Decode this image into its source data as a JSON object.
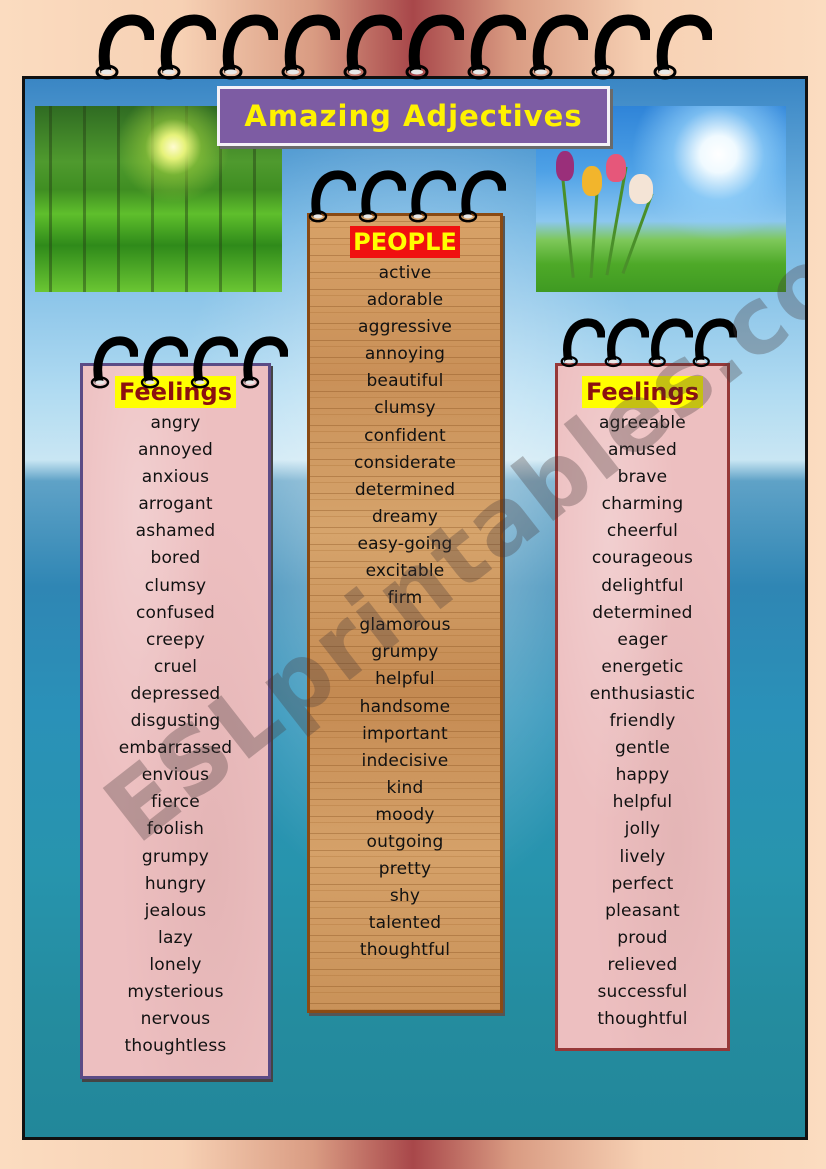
{
  "title": "Amazing Adjectives",
  "watermark": "ESLprintables.com",
  "colors": {
    "title_bg": "#7d5ca3",
    "title_text": "#fff200",
    "feelings_heading_bg": "#ffff00",
    "feelings_heading_text": "#8b1010",
    "people_heading_bg": "#f01010",
    "people_heading_text": "#ffff00",
    "left_panel_border": "#5b4b85",
    "right_panel_border": "#963838",
    "center_panel_border": "#8a4a13"
  },
  "images": {
    "left": "forest-sunlight-image",
    "right": "tulips-sky-image"
  },
  "left_panel": {
    "heading": "Feelings",
    "words": [
      "angry",
      "annoyed",
      "anxious",
      "arrogant",
      "ashamed",
      "bored",
      "clumsy",
      "confused",
      "creepy",
      "cruel",
      "depressed",
      "disgusting",
      "embarrassed",
      "envious",
      "fierce",
      "foolish",
      "grumpy",
      "hungry",
      "jealous",
      "lazy",
      "lonely",
      "mysterious",
      "nervous",
      "thoughtless"
    ]
  },
  "center_panel": {
    "heading": "PEOPLE",
    "words": [
      "active",
      "adorable",
      "aggressive",
      "annoying",
      "beautiful",
      "clumsy",
      "confident",
      "considerate",
      "determined",
      "dreamy",
      "easy-going",
      "excitable",
      "firm",
      "glamorous",
      "grumpy",
      "helpful",
      "handsome",
      "important",
      "indecisive",
      "kind",
      "moody",
      "outgoing",
      "pretty",
      "shy",
      "talented",
      "thoughtful"
    ]
  },
  "right_panel": {
    "heading": "Feelings",
    "words": [
      "agreeable",
      "amused",
      "brave",
      "charming",
      "cheerful",
      "courageous",
      "delightful",
      "determined",
      "eager",
      "energetic",
      "enthusiastic",
      "friendly",
      "gentle",
      "happy",
      "helpful",
      "jolly",
      "lively",
      "perfect",
      "pleasant",
      "proud",
      "relieved",
      "successful",
      "thoughtful"
    ]
  }
}
